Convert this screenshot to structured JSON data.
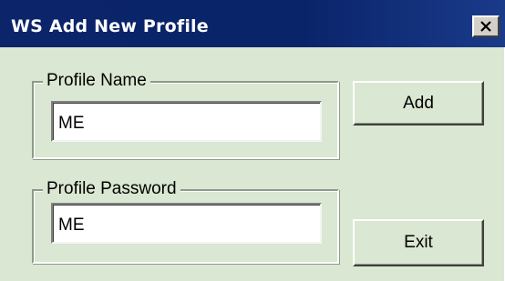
{
  "window": {
    "title": "WS Add New Profile",
    "close_icon": "close-icon"
  },
  "profile_name": {
    "label": "Profile Name",
    "value": "ME"
  },
  "profile_password": {
    "label": "Profile Password",
    "value": "ME"
  },
  "buttons": {
    "add_label": "Add",
    "exit_label": "Exit"
  },
  "colors": {
    "title_bar": "#0a246a",
    "dialog_background": "#dae7d2"
  }
}
